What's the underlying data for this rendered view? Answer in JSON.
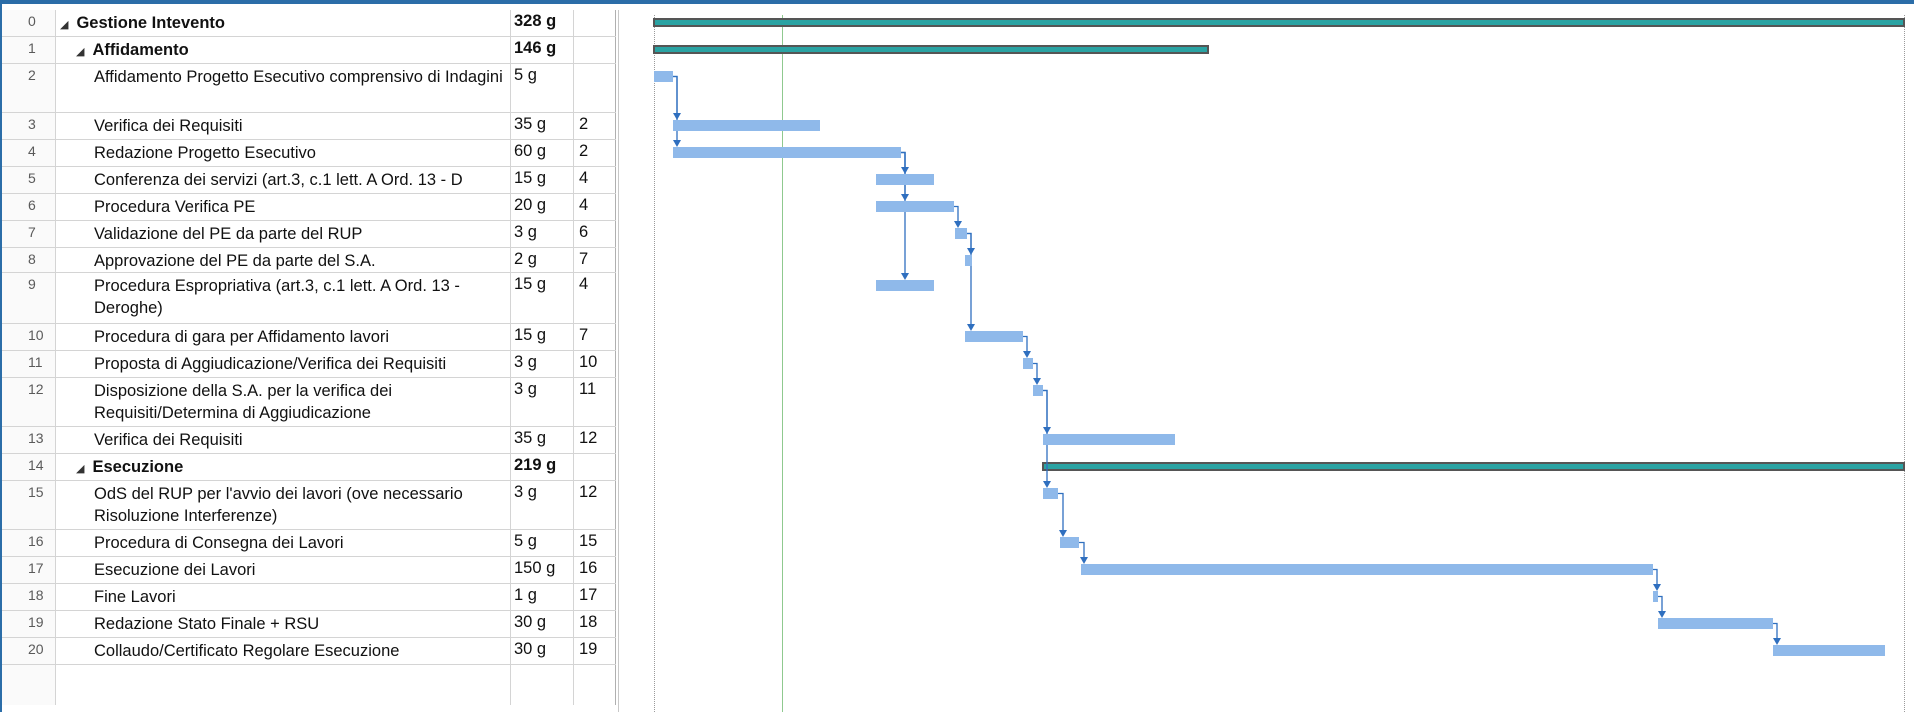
{
  "tasks": [
    {
      "id": "0",
      "name": "Gestione Intevento",
      "duration": "328 g",
      "pred": "",
      "level": 0,
      "summary": true
    },
    {
      "id": "1",
      "name": "Affidamento",
      "duration": "146 g",
      "pred": "",
      "level": 1,
      "summary": true
    },
    {
      "id": "2",
      "name": "Affidamento Progetto Esecutivo comprensivo di Indagini",
      "duration": "5 g",
      "pred": "",
      "level": 2,
      "summary": false
    },
    {
      "id": "3",
      "name": "Verifica dei Requisiti",
      "duration": "35 g",
      "pred": "2",
      "level": 2,
      "summary": false
    },
    {
      "id": "4",
      "name": "Redazione Progetto Esecutivo",
      "duration": "60 g",
      "pred": "2",
      "level": 2,
      "summary": false
    },
    {
      "id": "5",
      "name": "Conferenza dei servizi (art.3, c.1 lett. A  Ord. 13 - D",
      "duration": "15 g",
      "pred": "4",
      "level": 2,
      "summary": false
    },
    {
      "id": "6",
      "name": "Procedura Verifica PE",
      "duration": "20 g",
      "pred": "4",
      "level": 2,
      "summary": false
    },
    {
      "id": "7",
      "name": "Validazione del PE da parte del RUP",
      "duration": "3 g",
      "pred": "6",
      "level": 2,
      "summary": false
    },
    {
      "id": "8",
      "name": "Approvazione del PE da parte del S.A.",
      "duration": "2 g",
      "pred": "7",
      "level": 2,
      "summary": false
    },
    {
      "id": "9",
      "name": "Procedura Espropriativa (art.3, c.1 lett. A  Ord. 13 - Deroghe)",
      "duration": "15 g",
      "pred": "4",
      "level": 2,
      "summary": false
    },
    {
      "id": "10",
      "name": "Procedura di gara per Affidamento lavori",
      "duration": "15 g",
      "pred": "7",
      "level": 2,
      "summary": false
    },
    {
      "id": "11",
      "name": "Proposta di Aggiudicazione/Verifica dei Requisiti",
      "duration": "3 g",
      "pred": "10",
      "level": 2,
      "summary": false
    },
    {
      "id": "12",
      "name": "Disposizione della S.A. per la verifica dei Requisiti/Determina di Aggiudicazione",
      "duration": "3 g",
      "pred": "11",
      "level": 2,
      "summary": false
    },
    {
      "id": "13",
      "name": "Verifica dei Requisiti",
      "duration": "35 g",
      "pred": "12",
      "level": 2,
      "summary": false
    },
    {
      "id": "14",
      "name": "Esecuzione",
      "duration": "219 g",
      "pred": "",
      "level": 1,
      "summary": true
    },
    {
      "id": "15",
      "name": "OdS del RUP per l'avvio dei lavori (ove necessario Risoluzione Interferenze)",
      "duration": "3 g",
      "pred": "12",
      "level": 2,
      "summary": false
    },
    {
      "id": "16",
      "name": "Procedura di Consegna dei Lavori",
      "duration": "5 g",
      "pred": "15",
      "level": 2,
      "summary": false
    },
    {
      "id": "17",
      "name": "Esecuzione dei Lavori",
      "duration": "150 g",
      "pred": "16",
      "level": 2,
      "summary": false
    },
    {
      "id": "18",
      "name": "Fine Lavori",
      "duration": "1 g",
      "pred": "17",
      "level": 2,
      "summary": false
    },
    {
      "id": "19",
      "name": "Redazione Stato Finale + RSU",
      "duration": "30 g",
      "pred": "18",
      "level": 2,
      "summary": false
    },
    {
      "id": "20",
      "name": "Collaudo/Certificato Regolare Esecuzione",
      "duration": "30 g",
      "pred": "19",
      "level": 2,
      "summary": false
    }
  ],
  "colors": {
    "task_bar": "#8fb9ea",
    "summary_bar": "#2aa3a3",
    "summary_frame": "#555555",
    "link": "#2f6fbf",
    "today_line": "#8fc98f"
  }
}
